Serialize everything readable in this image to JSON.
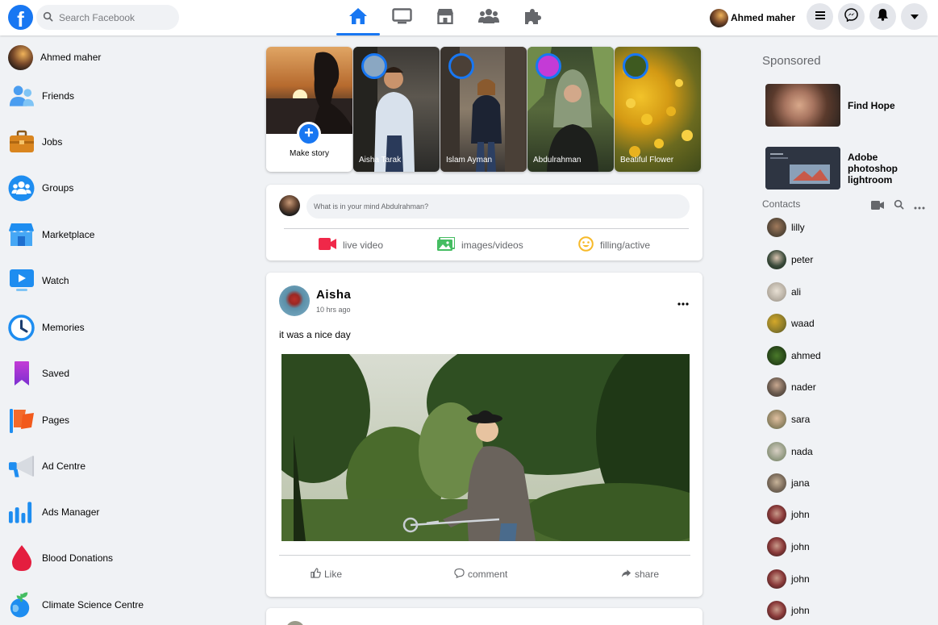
{
  "header": {
    "logo": "f",
    "search": {
      "placeholder": "Search Facebook",
      "value": ""
    },
    "nav": [
      {
        "name": "home",
        "active": true
      },
      {
        "name": "watch",
        "active": false
      },
      {
        "name": "marketplace",
        "active": false
      },
      {
        "name": "groups",
        "active": false
      },
      {
        "name": "gaming",
        "active": false
      }
    ],
    "profile_name": "Ahmed maher",
    "actions": [
      "menu-icon",
      "messenger-icon",
      "bell-icon",
      "caret-down-icon"
    ]
  },
  "sidebar": {
    "profile": "Ahmed maher",
    "items": [
      {
        "label": "Friends",
        "icon": "friends-icon"
      },
      {
        "label": "Jobs",
        "icon": "briefcase-icon"
      },
      {
        "label": "Groups",
        "icon": "groups-icon"
      },
      {
        "label": "Marketplace",
        "icon": "shop-icon"
      },
      {
        "label": "Watch",
        "icon": "watch-icon"
      },
      {
        "label": "Memories",
        "icon": "clock-icon"
      },
      {
        "label": "Saved",
        "icon": "bookmark-icon"
      },
      {
        "label": "Pages",
        "icon": "flag-icon"
      },
      {
        "label": "Ad Centre",
        "icon": "megaphone-icon"
      },
      {
        "label": "Ads Manager",
        "icon": "bar-chart-icon"
      },
      {
        "label": "Blood Donations",
        "icon": "blood-drop-icon"
      },
      {
        "label": "Climate Science Centre",
        "icon": "globe-sprout-icon"
      }
    ]
  },
  "stories": {
    "make_label": "Make story",
    "items": [
      {
        "name": "Aisha Tarak"
      },
      {
        "name": "Islam Ayman"
      },
      {
        "name": "Abdulrahman"
      },
      {
        "name": "Beatiful Flower"
      }
    ]
  },
  "composer": {
    "placeholder": "What is in your mind Abdulrahman?",
    "actions": [
      {
        "label": "live video",
        "icon": "video-camera-icon",
        "color": "#f02849"
      },
      {
        "label": "images/videos",
        "icon": "photo-icon",
        "color": "#45bd62"
      },
      {
        "label": "filling/active",
        "icon": "smiley-icon",
        "color": "#f7b928"
      }
    ]
  },
  "post": {
    "author": "Aisha",
    "time": "10 hrs ago",
    "caption": "it was a nice day",
    "actions": [
      {
        "label": "Like",
        "icon": "thumbs-up-icon"
      },
      {
        "label": "comment",
        "icon": "comment-icon"
      },
      {
        "label": "share",
        "icon": "share-icon"
      }
    ]
  },
  "right": {
    "sponsored_heading": "Sponsored",
    "ads": [
      {
        "title": "Find Hope"
      },
      {
        "title": "Adobe photoshop lightroom"
      }
    ],
    "contacts_heading": "Contacts",
    "contacts": [
      "lilly",
      "peter",
      "ali",
      "waad",
      "ahmed",
      "nader",
      "sara",
      "nada",
      "jana",
      "john",
      "john",
      "john",
      "john"
    ]
  },
  "colors": {
    "brand": "#1877f2",
    "background": "#f0f2f5"
  }
}
